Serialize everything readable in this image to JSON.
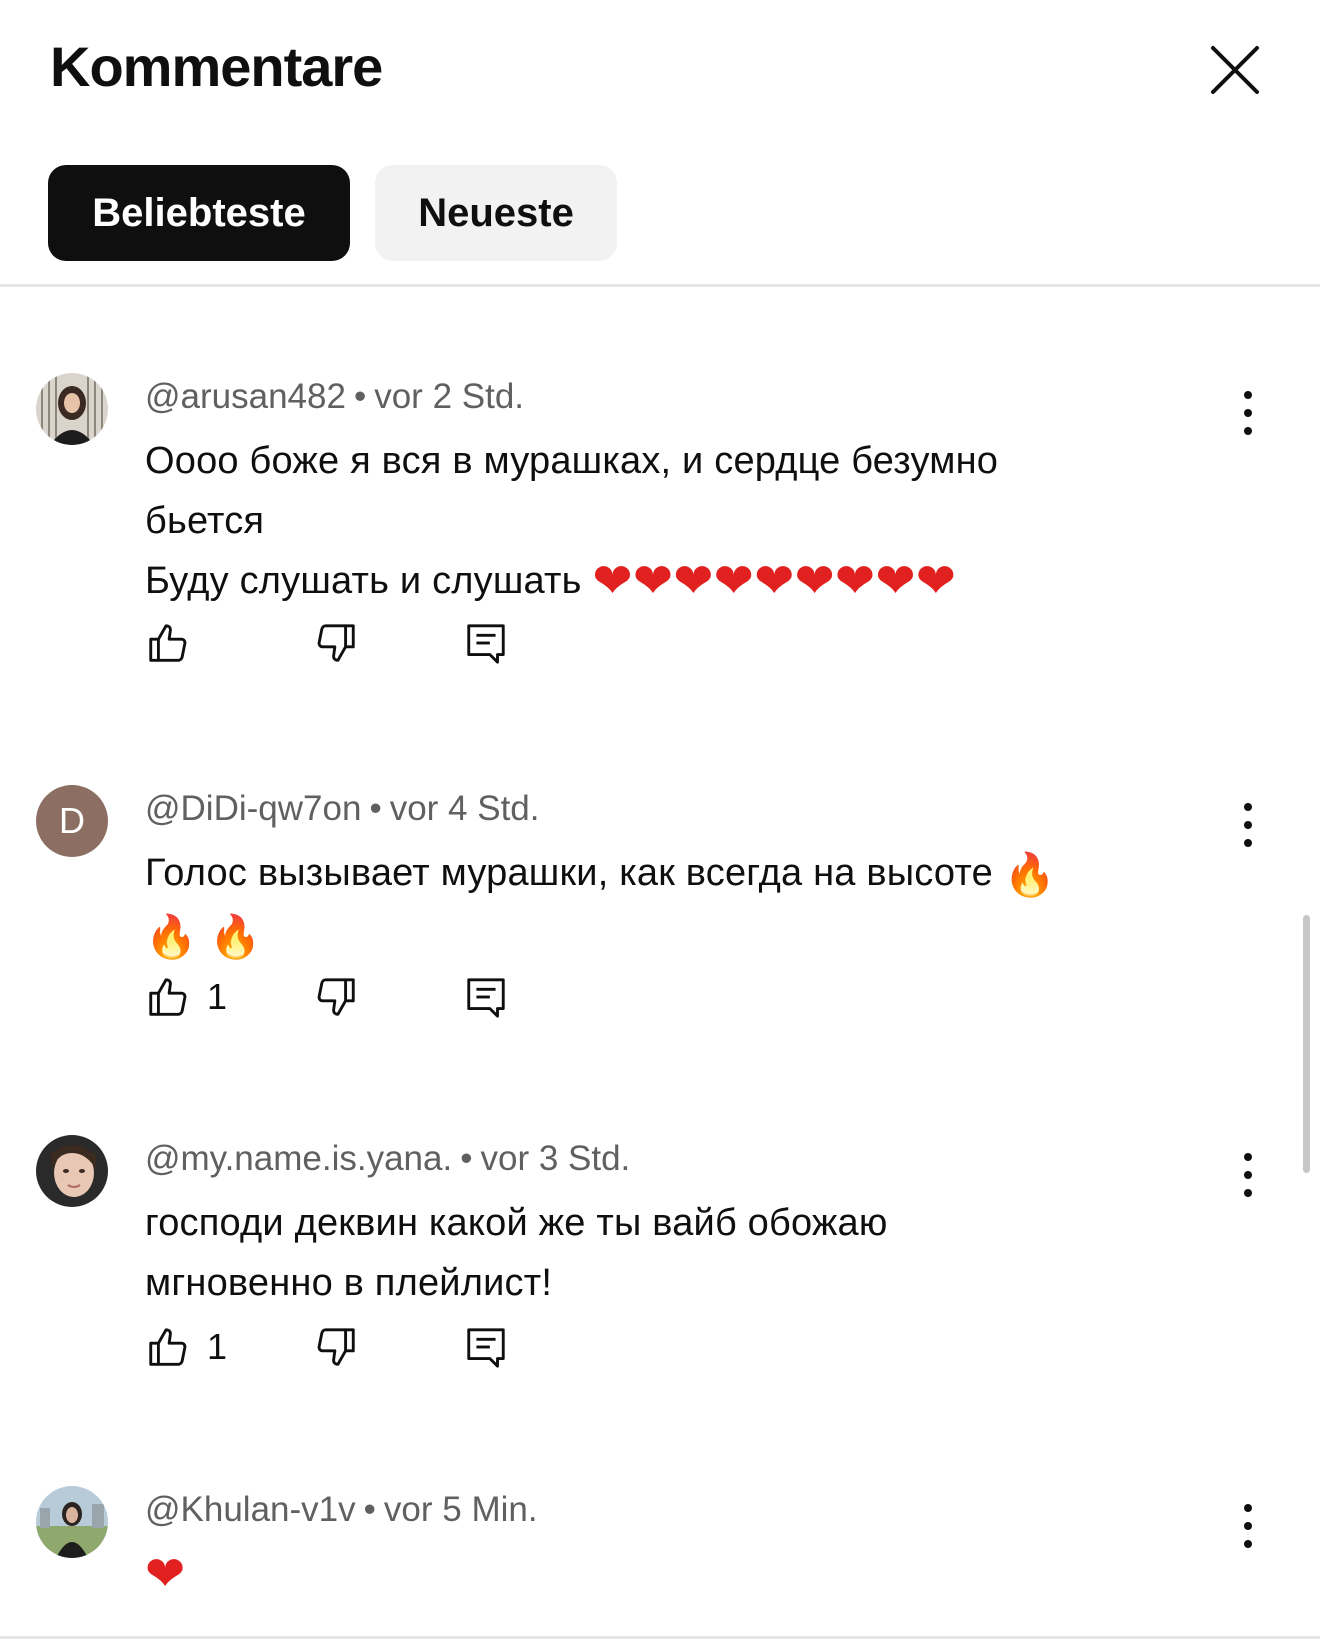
{
  "header": {
    "title": "Kommentare",
    "close_icon": "close-icon"
  },
  "tabs": [
    {
      "label": "Beliebteste",
      "active": true
    },
    {
      "label": "Neueste",
      "active": false
    }
  ],
  "comments": [
    {
      "author": "@arusan482",
      "time": "vor 2 Std.",
      "lines": [
        "Оооо боже я вся в мурашках, и сердце безумно",
        "бьется",
        "Буду слушать и слушать"
      ],
      "emoji": "❤❤❤❤❤❤❤❤❤",
      "likes": "",
      "avatar": "photo"
    },
    {
      "author": "@DiDi-qw7on",
      "time": "vor 4 Std.",
      "lines": [
        "Голос вызывает мурашки, как всегда на высоте"
      ],
      "emoji_inline": "🔥",
      "emoji_next": "🔥 🔥",
      "likes": "1",
      "avatar_letter": "D",
      "avatar_color": "#8d6e63"
    },
    {
      "author": "@my.name.is.yana.",
      "time": "vor 3 Std.",
      "lines": [
        "господи деквин какой же ты вайб обожаю",
        "мгновенно в плейлист!"
      ],
      "likes": "1",
      "avatar": "photo"
    },
    {
      "author": "@Khulan-v1v",
      "time": "vor 5 Min.",
      "emoji": "❤",
      "likes": "",
      "avatar": "photo"
    }
  ],
  "icons": {
    "like": "thumb-up-icon",
    "dislike": "thumb-down-icon",
    "reply": "reply-icon",
    "more": "more-vertical-icon"
  },
  "colors": {
    "text": "#0f0f0f",
    "secondary": "#606060",
    "chip_active": "#0f0f0f",
    "chip_inactive": "#f2f2f2",
    "heart": "#e0211f"
  }
}
